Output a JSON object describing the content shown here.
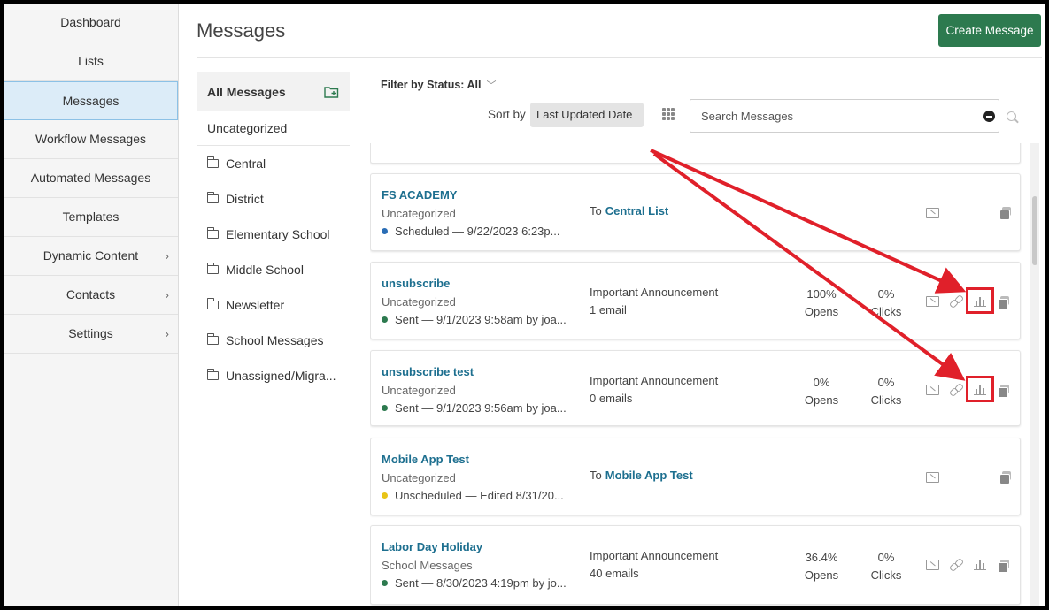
{
  "sidebar": {
    "items": [
      {
        "label": "Dashboard"
      },
      {
        "label": "Lists"
      },
      {
        "label": "Messages"
      },
      {
        "label": "Workflow Messages"
      },
      {
        "label": "Automated Messages"
      },
      {
        "label": "Templates"
      },
      {
        "label": "Dynamic Content"
      },
      {
        "label": "Contacts"
      },
      {
        "label": "Settings"
      }
    ],
    "active": "Messages",
    "chevron": "›"
  },
  "header": {
    "title": "Messages",
    "create_label": "Create Message"
  },
  "folders": {
    "heading": "All Messages",
    "uncategorized": "Uncategorized",
    "items": [
      "Central",
      "District",
      "Elementary School",
      "Middle School",
      "Newsletter",
      "School Messages",
      "Unassigned/Migra..."
    ]
  },
  "toolbar": {
    "filter_label": "Filter by Status: All",
    "filter_caret": "﹀",
    "sort_label": "Sort by",
    "sort_value": "Last Updated Date",
    "search_placeholder": "Search Messages"
  },
  "messages": [
    {
      "name": "FS ACADEMY",
      "folder": "Uncategorized",
      "status": "Scheduled — 9/22/2023 6:23p...",
      "status_color": "#2a6db5",
      "to_prefix": "To",
      "to_list": "Central List"
    },
    {
      "name": "unsubscribe",
      "folder": "Uncategorized",
      "status": "Sent — 9/1/2023 9:58am by joa...",
      "status_color": "#2d7a4f",
      "subject": "Important Announcement",
      "count": "1 email",
      "opens_value": "100%",
      "opens_label": "Opens",
      "clicks_value": "0%",
      "clicks_label": "Clicks"
    },
    {
      "name": "unsubscribe test",
      "folder": "Uncategorized",
      "status": "Sent — 9/1/2023 9:56am by joa...",
      "status_color": "#2d7a4f",
      "subject": "Important Announcement",
      "count": "0 emails",
      "opens_value": "0%",
      "opens_label": "Opens",
      "clicks_value": "0%",
      "clicks_label": "Clicks"
    },
    {
      "name": "Mobile App Test",
      "folder": "Uncategorized",
      "status": "Unscheduled — Edited 8/31/20...",
      "status_color": "#e8c417",
      "to_prefix": "To",
      "to_list": "Mobile App Test"
    },
    {
      "name": "Labor Day Holiday",
      "folder": "School Messages",
      "status": "Sent — 8/30/2023 4:19pm by jo...",
      "status_color": "#2d7a4f",
      "subject": "Important Announcement",
      "count": "40 emails",
      "opens_value": "36.4%",
      "opens_label": "Opens",
      "clicks_value": "0%",
      "clicks_label": "Clicks"
    }
  ],
  "annotation_color": "#e0202a"
}
